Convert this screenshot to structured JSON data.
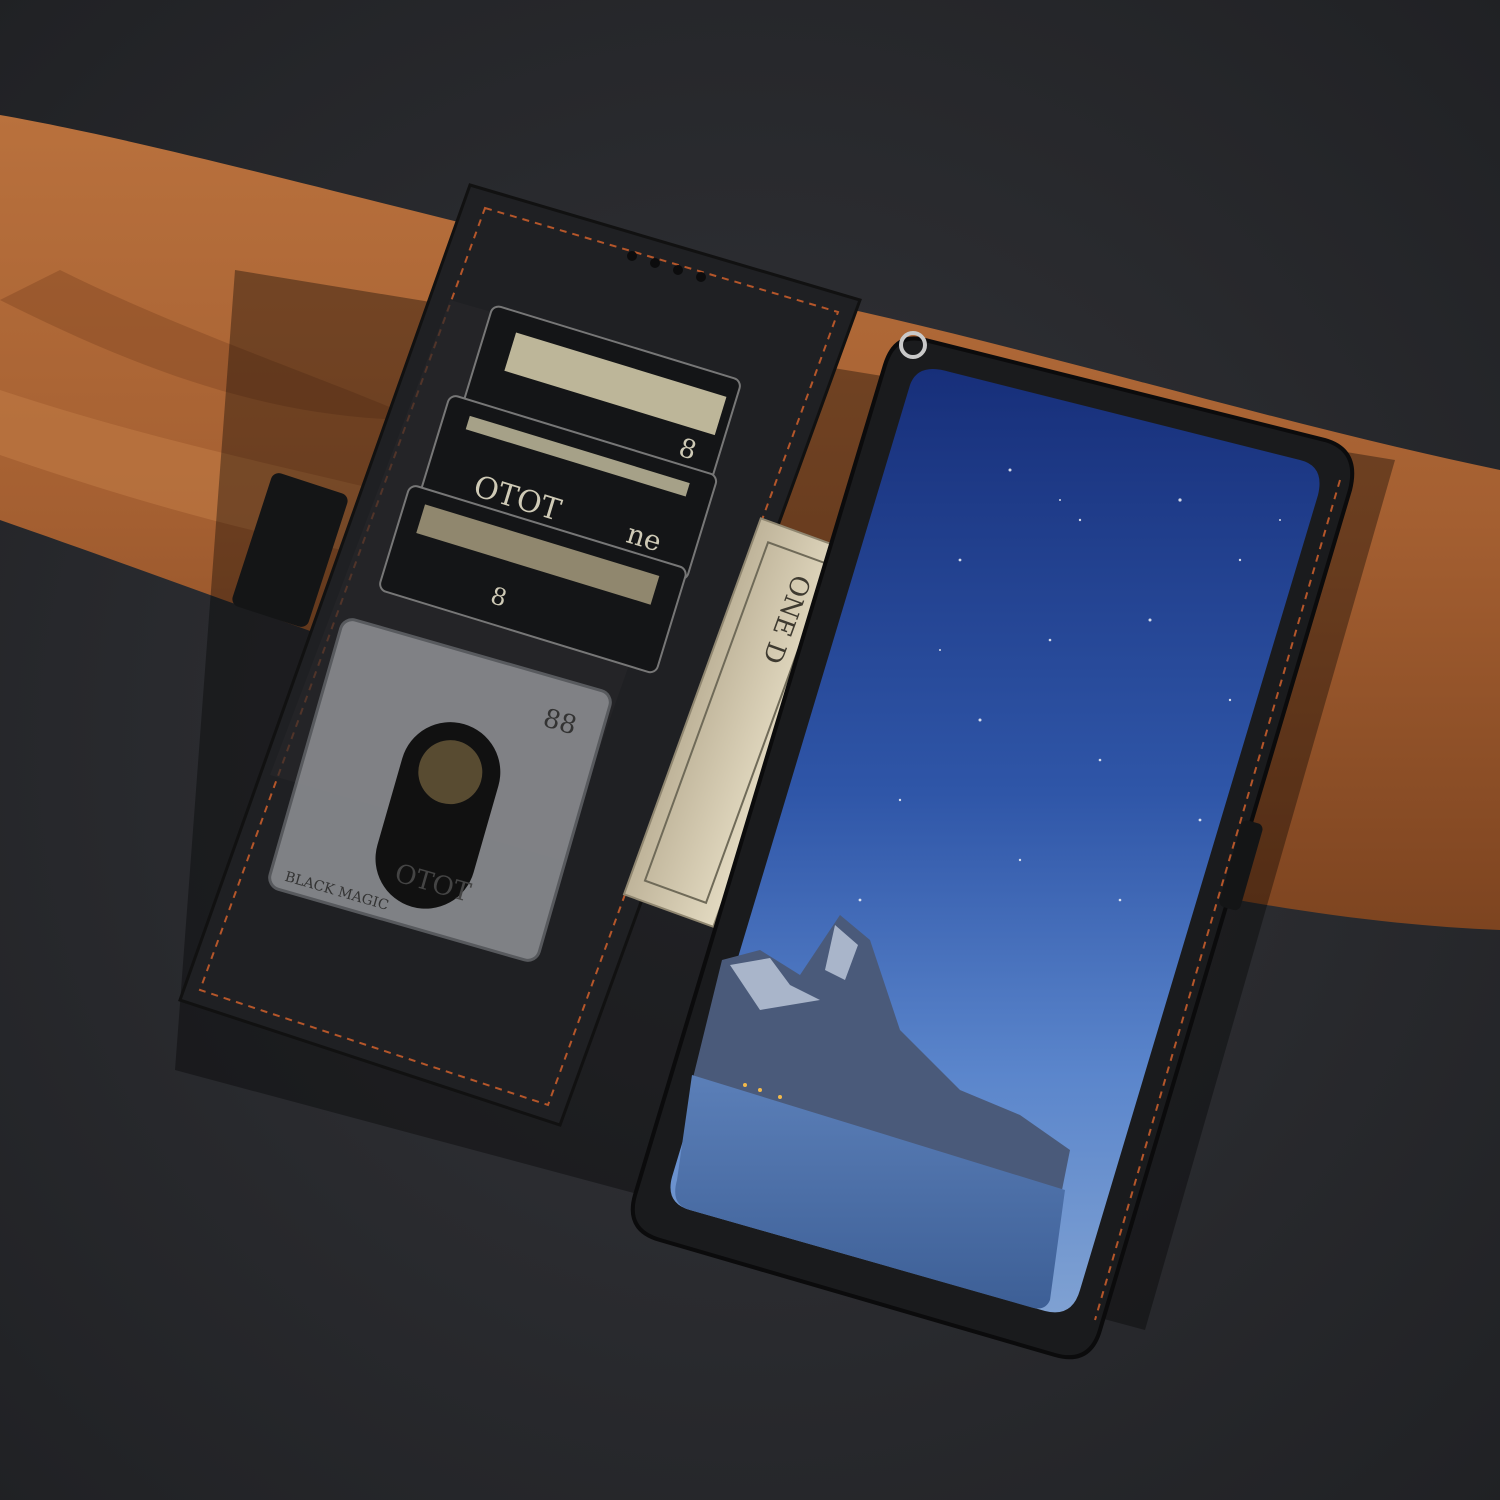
{
  "scene": {
    "subject": "black leather flip wallet phone case",
    "background_color": "#2a2b2e",
    "leather_color": "#a76335",
    "case_color": "#1f2022",
    "stitch_color": "#b5562a",
    "screen_top_color": "#1f3a8a",
    "screen_bottom_color": "#6a8ec9"
  },
  "cards": {
    "card1_text": "8",
    "card2_text": "OTOT",
    "card2_side_text": "ne",
    "card3_text": "8",
    "id_card_number": "88",
    "id_card_name": "OTOT",
    "id_card_side": "BLACK MAGIC"
  },
  "banknote": {
    "text": "ONE D"
  }
}
